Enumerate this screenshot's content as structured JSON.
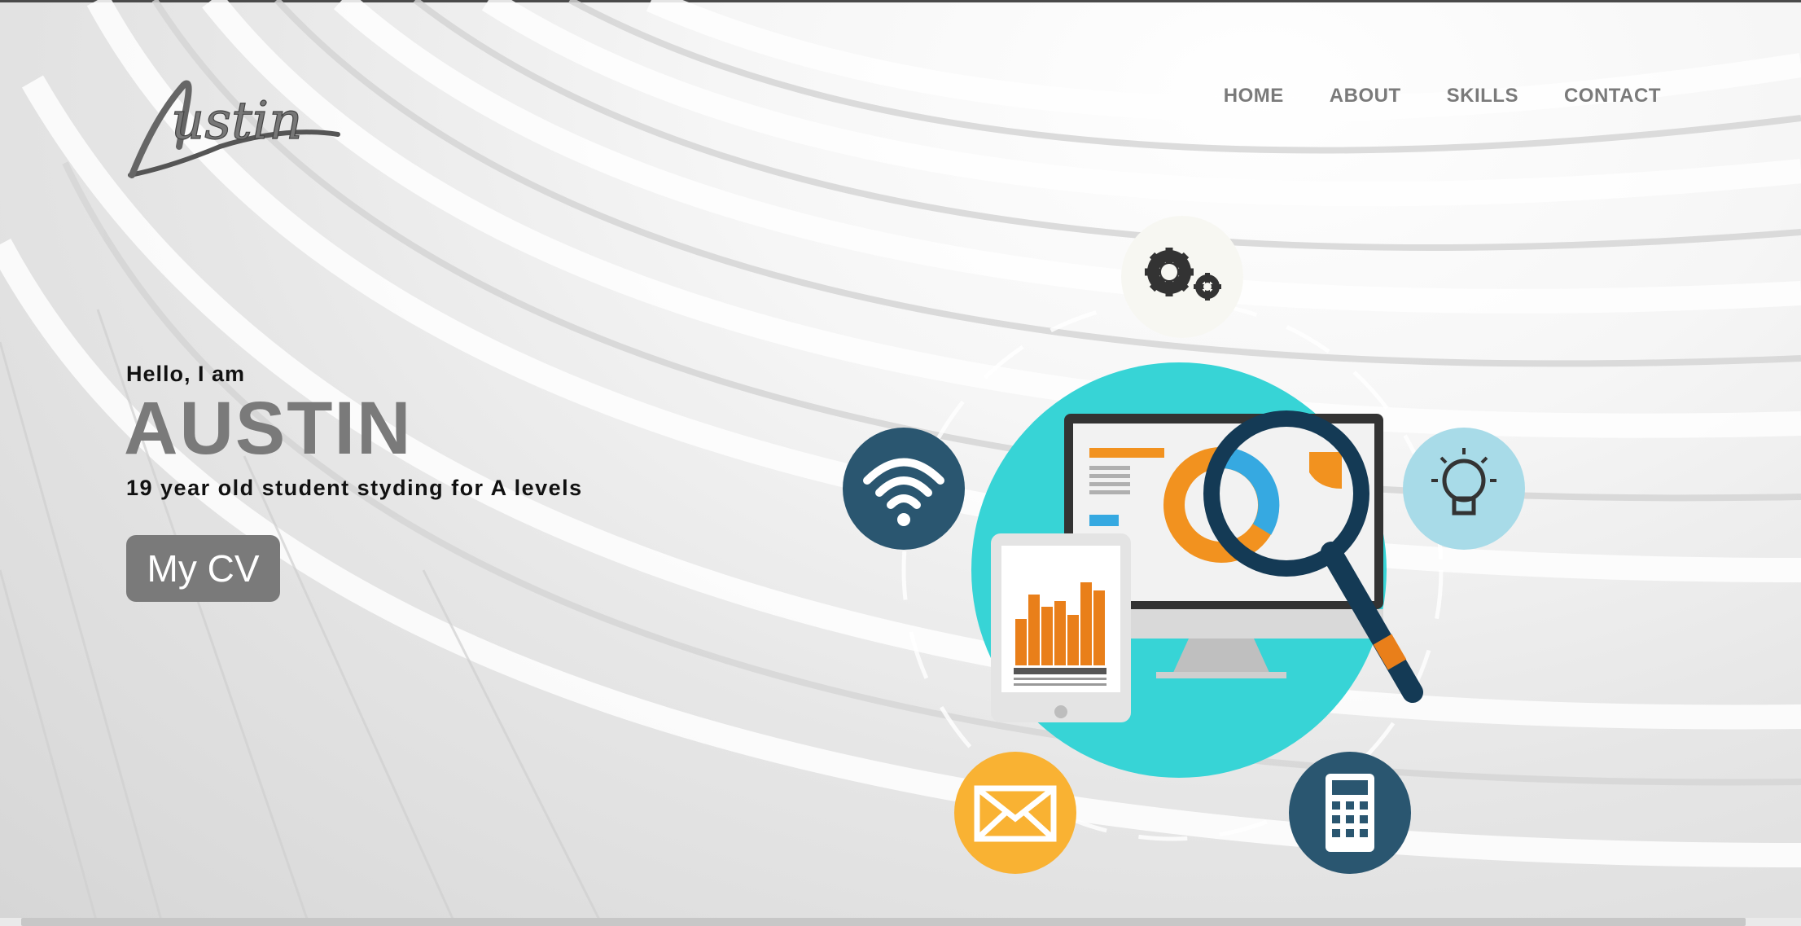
{
  "site": {
    "logo_text": "Austin"
  },
  "nav": {
    "items": [
      "HOME",
      "ABOUT",
      "SKILLS",
      "CONTACT"
    ]
  },
  "hero": {
    "greeting": "Hello, I am",
    "name": "AUSTIN",
    "tagline": "19 year old student styding for A levels",
    "cv_button": "My CV"
  },
  "colors": {
    "accent_gray": "#7a7a7a",
    "teal": "#37d4d6",
    "dark_blue": "#2a5670",
    "orange": "#f2921f",
    "yellow": "#f9b233",
    "light_blue": "#a8dbe8"
  },
  "icons": [
    "gears-icon",
    "wifi-icon",
    "lightbulb-icon",
    "envelope-icon",
    "calculator-icon",
    "monitor-icon",
    "tablet-icon",
    "magnifier-icon"
  ]
}
